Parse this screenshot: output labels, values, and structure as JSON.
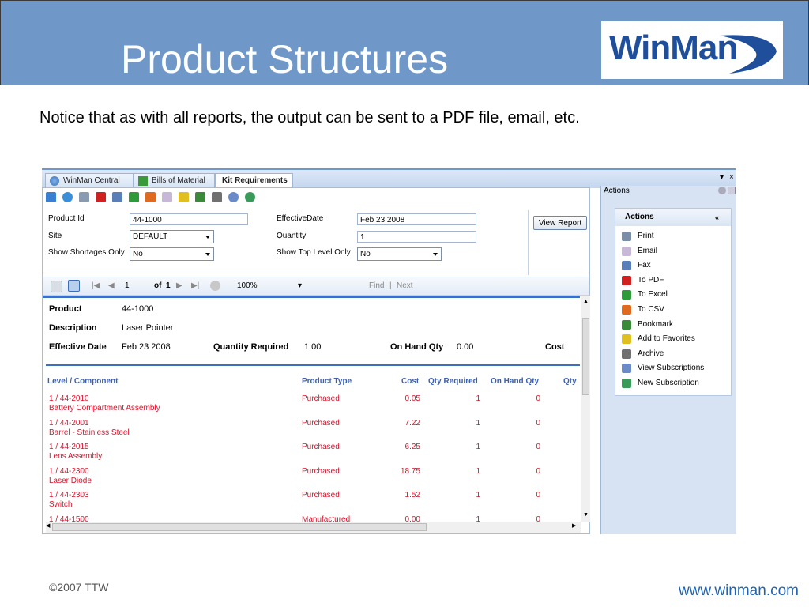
{
  "slide": {
    "title": "Product Structures",
    "logo_text": "WinMan",
    "notice": "Notice that as with all reports, the output can be sent to a PDF file, email, etc.",
    "footer_left": "©2007 TTW",
    "footer_right": "www.winman.com"
  },
  "tabs": [
    {
      "label": "WinMan Central"
    },
    {
      "label": "Bills of Material"
    },
    {
      "label": "Kit Requirements",
      "active": true
    }
  ],
  "toolbar_icons": [
    "back-icon",
    "refresh-icon",
    "print-icon",
    "pdf-icon",
    "fax-icon",
    "excel-icon",
    "csv-icon",
    "email-icon",
    "favorites-icon",
    "bookmark-icon",
    "archive-icon",
    "view-subscriptions-icon",
    "new-subscription-icon"
  ],
  "params": {
    "product_id_label": "Product Id",
    "product_id_value": "44-1000",
    "site_label": "Site",
    "site_value": "DEFAULT",
    "shortages_label": "Show Shortages Only",
    "shortages_value": "No",
    "effective_date_label": "EffectiveDate",
    "effective_date_value": "Feb 23 2008",
    "quantity_label": "Quantity",
    "quantity_value": "1",
    "top_level_label": "Show Top Level Only",
    "top_level_value": "No",
    "view_report_label": "View Report"
  },
  "nav": {
    "page": "1",
    "of_label": "of",
    "total": "1",
    "zoom": "100%",
    "find_label": "Find",
    "next_label": "Next"
  },
  "report_header": {
    "product_label": "Product",
    "product_value": "44-1000",
    "description_label": "Description",
    "description_value": "Laser Pointer",
    "effective_date_label": "Effective Date",
    "effective_date_value": "Feb 23 2008",
    "qty_required_label": "Quantity Required",
    "qty_required_value": "1.00",
    "on_hand_label": "On Hand Qty",
    "on_hand_value": "0.00",
    "cost_label": "Cost"
  },
  "table": {
    "headers": [
      "Level / Component",
      "Product Type",
      "Cost",
      "Qty Required",
      "On Hand Qty",
      "Qty"
    ],
    "rows": [
      {
        "level": "1 / 44-2010",
        "component": "Battery Compartment Assembly",
        "type": "Purchased",
        "cost": "0.05",
        "qty_required": "1",
        "on_hand": "0"
      },
      {
        "level": "1 / 44-2001",
        "component": "Barrel - Stainless Steel",
        "type": "Purchased",
        "cost": "7.22",
        "qty_required": "1",
        "on_hand": "0"
      },
      {
        "level": "1 / 44-2015",
        "component": "Lens Assembly",
        "type": "Purchased",
        "cost": "6.25",
        "qty_required": "1",
        "on_hand": "0"
      },
      {
        "level": "1 / 44-2300",
        "component": "Laser Diode",
        "type": "Purchased",
        "cost": "18.75",
        "qty_required": "1",
        "on_hand": "0"
      },
      {
        "level": "1 / 44-2303",
        "component": "Switch",
        "type": "Purchased",
        "cost": "1.52",
        "qty_required": "1",
        "on_hand": "0"
      },
      {
        "level": "1 / 44-1500",
        "component": "",
        "type": "Manufactured",
        "cost": "0.00",
        "qty_required": "1",
        "on_hand": "0"
      }
    ]
  },
  "actions_pane": {
    "title": "Actions",
    "box_title": "Actions",
    "items": [
      {
        "label": "Print",
        "icon": "print-icon",
        "color": "#7a8ea8"
      },
      {
        "label": "Email",
        "icon": "email-icon",
        "color": "#c8b8d8"
      },
      {
        "label": "Fax",
        "icon": "fax-icon",
        "color": "#5a7fb8"
      },
      {
        "label": "To PDF",
        "icon": "pdf-icon",
        "color": "#d02020"
      },
      {
        "label": "To Excel",
        "icon": "excel-icon",
        "color": "#2e9a3a"
      },
      {
        "label": "To CSV",
        "icon": "csv-icon",
        "color": "#e06a20"
      },
      {
        "label": "Bookmark",
        "icon": "bookmark-icon",
        "color": "#3a8a3a"
      },
      {
        "label": "Add to Favorites",
        "icon": "favorites-icon",
        "color": "#e0c020"
      },
      {
        "label": "Archive",
        "icon": "archive-icon",
        "color": "#707070"
      },
      {
        "label": "View Subscriptions",
        "icon": "view-subscriptions-icon",
        "color": "#6a8ac8"
      },
      {
        "label": "New Subscription",
        "icon": "new-subscription-icon",
        "color": "#3a9a5a"
      }
    ]
  }
}
